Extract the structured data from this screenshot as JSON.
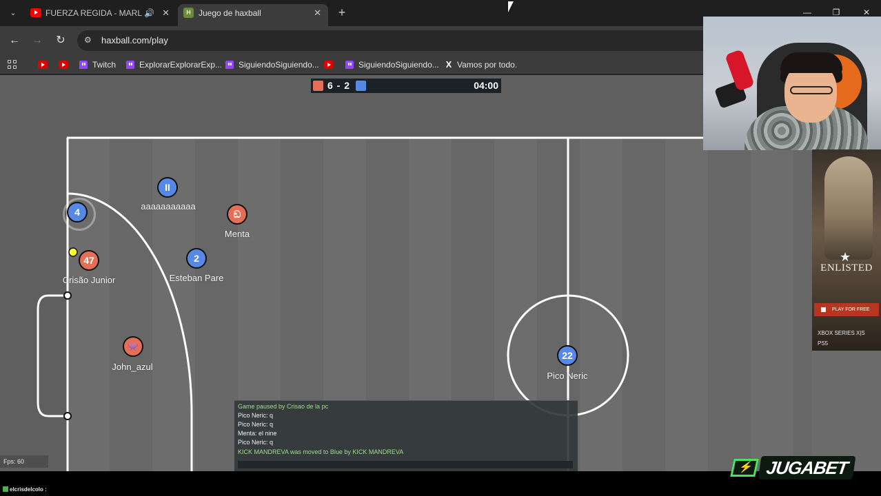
{
  "browser": {
    "tabs": [
      {
        "title": "FUERZA REGIDA - MARLBORO",
        "icon": "youtube-icon",
        "audio": "speaker-icon"
      },
      {
        "title": "Juego de haxball",
        "icon": "haxball-icon"
      }
    ],
    "url": "haxball.com/play",
    "bookmarks": [
      {
        "label": "",
        "icon": "youtube-icon"
      },
      {
        "label": "",
        "icon": "youtube-icon"
      },
      {
        "label": "Twitch",
        "icon": "twitch-icon"
      },
      {
        "label": "ExplorarExplorarExp...",
        "icon": "twitch-icon"
      },
      {
        "label": "SiguiendoSiguiendo...",
        "icon": "twitch-icon"
      },
      {
        "label": "",
        "icon": "youtube-icon"
      },
      {
        "label": "SiguiendoSiguiendo...",
        "icon": "twitch-icon"
      },
      {
        "label": "Vamos por todo.",
        "icon": "x-icon"
      }
    ]
  },
  "game": {
    "score": "6 - 2",
    "time": "04:00",
    "team_colors": {
      "red": "#e56e56",
      "blue": "#5689e5"
    },
    "players": [
      {
        "name": "",
        "avatar": "4",
        "team": "blue"
      },
      {
        "name": "aaaaaaaaaaa",
        "avatar": "II",
        "team": "blue"
      },
      {
        "name": "Menta",
        "avatar": "ඞ",
        "team": "red"
      },
      {
        "name": "Crisão Junior",
        "avatar": "47",
        "team": "red"
      },
      {
        "name": "Esteban Pare",
        "avatar": "2",
        "team": "blue"
      },
      {
        "name": "John_azul",
        "avatar": "👾",
        "team": "red"
      },
      {
        "name": "Pico Neric",
        "avatar": "22",
        "team": "blue"
      }
    ],
    "fps": "Fps: 60",
    "chat": [
      {
        "text": "Game paused by Crisao de la pc",
        "kind": "notice"
      },
      {
        "text": "Pico Neric: q",
        "kind": "msg"
      },
      {
        "text": "Pico Neric: q",
        "kind": "msg"
      },
      {
        "text": "Menta: el nine",
        "kind": "msg"
      },
      {
        "text": "Pico Neric: q",
        "kind": "msg"
      },
      {
        "text": "KICK MANDREVA was moved to Blue by KICK MANDREVA",
        "kind": "notice"
      }
    ]
  },
  "ad": {
    "brand": "ENLISTED",
    "cta": "PLAY FOR FREE",
    "platform1": "XBOX SERIES X|S",
    "platform2": "PS5"
  },
  "overlay": {
    "sponsor": "JUGABET",
    "chat_user": "elcrisdelcolo :"
  }
}
